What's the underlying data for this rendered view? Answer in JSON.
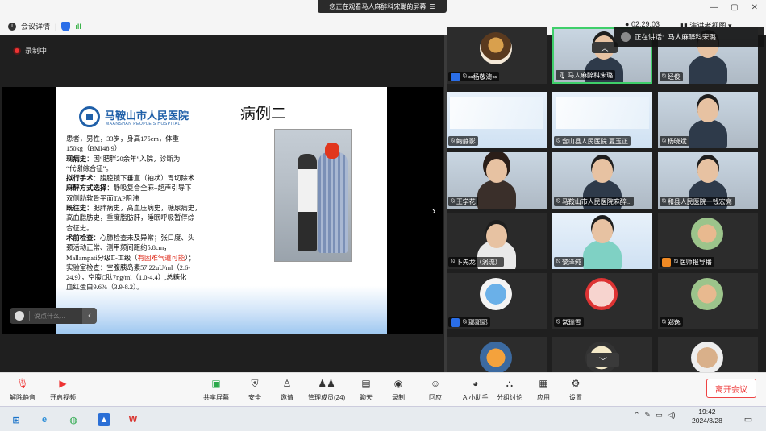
{
  "banner": {
    "text": "您正在观看马人麻醉科宋璐的屏幕",
    "menu_icon": "menu-icon"
  },
  "window": {
    "minimize": "—",
    "maximize": "▢",
    "close": "✕"
  },
  "meeting": {
    "info_label": "会议详情",
    "time": "02:29:03",
    "view_label": "演讲者视图",
    "recording_label": "录制中"
  },
  "speaking": {
    "prefix": "正在讲话:",
    "name": "马人麻醉科宋璐"
  },
  "slide": {
    "hospital_cn": "马鞍山市人民医院",
    "hospital_en": "MAANSHAN PEOPLE'S HOSPITAL",
    "title": "病例二",
    "lines": [
      {
        "pre": "",
        "bold": "",
        "text": "患者，男性，33岁，身高175cm，体重",
        "red": ""
      },
      {
        "pre": "",
        "bold": "",
        "text": "150kg（BMI48.9）",
        "red": ""
      },
      {
        "pre": "",
        "bold": "现病史",
        "text": "：因“肥胖20余年”入院，诊断为",
        "red": ""
      },
      {
        "pre": "",
        "bold": "",
        "text": "“代谢综合征”。",
        "red": ""
      },
      {
        "pre": "",
        "bold": "拟行手术",
        "text": "：腹腔镜下垂直（袖状）胃切除术",
        "red": ""
      },
      {
        "pre": "",
        "bold": "麻醉方式选择",
        "text": "：静吸复合全麻+超声引导下",
        "red": ""
      },
      {
        "pre": "",
        "bold": "",
        "text": "双侧肋软骨平面TAP阻滞",
        "red": ""
      },
      {
        "pre": "",
        "bold": "既往史",
        "text": "：肥胖病史，高血压病史，糖尿病史，",
        "red": ""
      },
      {
        "pre": "",
        "bold": "",
        "text": "高血脂肪史，重度脂肪肝，睡眠呼吸暂停综",
        "red": ""
      },
      {
        "pre": "",
        "bold": "",
        "text": "合征史。",
        "red": ""
      },
      {
        "pre": "",
        "bold": "术前检查",
        "text": "：心肺检查未及异常；张口度、头",
        "red": ""
      },
      {
        "pre": "",
        "bold": "",
        "text": "颈活动正常、测甲颏间距约5.8cm，",
        "red": ""
      },
      {
        "pre": "",
        "bold": "",
        "text": "Mallampati分级Ⅱ-Ⅲ级（",
        "red": "有困难气道可能",
        "post": "）；"
      },
      {
        "pre": "",
        "bold": "",
        "text": "实验室检查：空腹胰岛素57.22uU/ml（2.6-",
        "red": ""
      },
      {
        "pre": "",
        "bold": "",
        "text": "24.9），空腹C肽7ng/ml（1.0-4.4）,总糖化",
        "red": ""
      },
      {
        "pre": "",
        "bold": "",
        "text": "血红蛋白9.6%（3.9-8.2）。",
        "red": ""
      }
    ]
  },
  "chat": {
    "placeholder": "说点什么...",
    "collapse_icon": "chevron-left-icon"
  },
  "participants": [
    {
      "name": "∞杨敬涛∞",
      "host": true
    },
    {
      "name": "马人麻醉科宋璐",
      "host": false,
      "active": true
    },
    {
      "name": "经俊",
      "host": false
    },
    {
      "name": "鲍静影",
      "host": false
    },
    {
      "name": "含山县人民医院 夏玉正",
      "host": false
    },
    {
      "name": "杨晓斌",
      "host": false
    },
    {
      "name": "王学花",
      "host": false
    },
    {
      "name": "马鞍山市人民医院麻醉...",
      "host": false
    },
    {
      "name": "和县人民医院一钱宏亮",
      "host": false
    },
    {
      "name": "卜先龙（涡流）",
      "host": false
    },
    {
      "name": "黎泽纯",
      "host": false
    },
    {
      "name": "医师报导播",
      "host": true
    },
    {
      "name": "耶耶耶",
      "host": true
    },
    {
      "name": "常瑞雪",
      "host": false
    },
    {
      "name": "郑逸",
      "host": false
    }
  ],
  "toolbar": {
    "mute": "解除静音",
    "video": "开启视频",
    "share": "共享屏幕",
    "security": "安全",
    "invite": "邀请",
    "members": "管理成员(24)",
    "chat": "聊天",
    "record": "录制",
    "react": "回应",
    "ai": "AI小助手",
    "breakout": "分组讨论",
    "apps": "应用",
    "settings": "设置",
    "leave": "离开会议"
  },
  "taskbar": {
    "time": "19:42",
    "date": "2024/8/28"
  }
}
